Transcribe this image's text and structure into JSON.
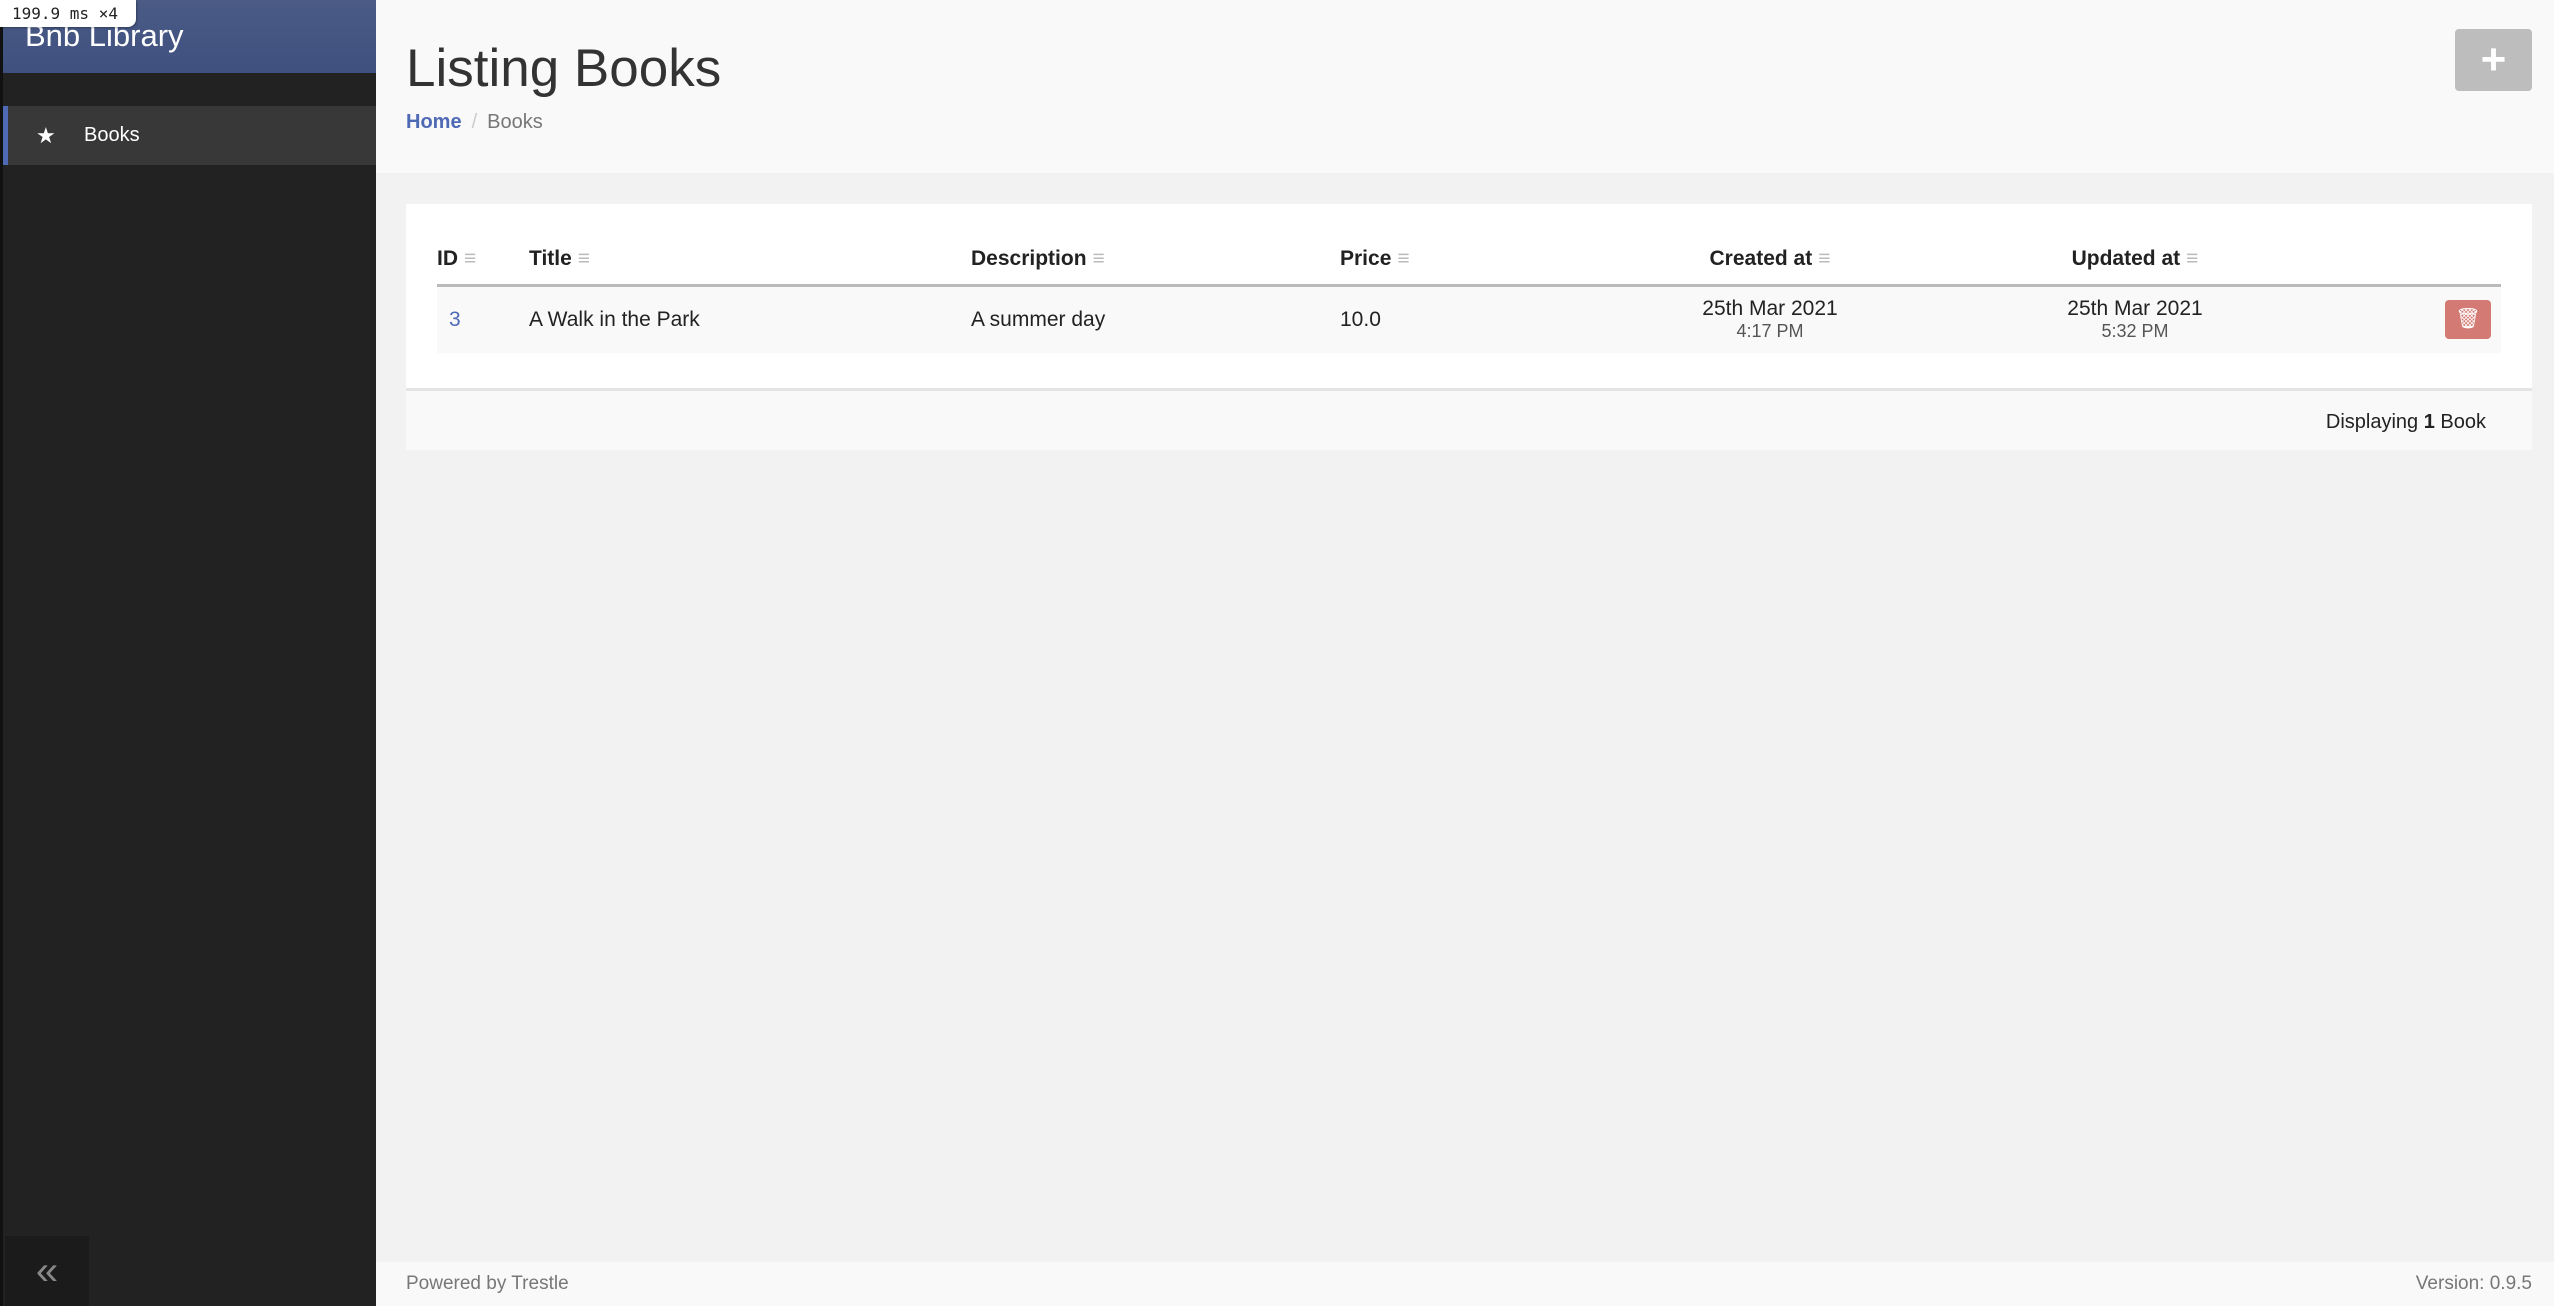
{
  "overlay": {
    "timing": "199.9 ms ×4"
  },
  "sidebar": {
    "brand": "Bnb Library",
    "items": [
      {
        "label": "Books",
        "icon": "star-icon"
      }
    ],
    "collapse_icon": "double-chevron-left-icon"
  },
  "header": {
    "title": "Listing Books",
    "breadcrumb": [
      "Home",
      "Books"
    ],
    "add_icon": "+"
  },
  "table": {
    "columns": [
      "ID",
      "Title",
      "Description",
      "Price",
      "Created at",
      "Updated at"
    ],
    "rows": [
      {
        "id": "3",
        "title": "A Walk in the Park",
        "description": "A summer day",
        "price": "10.0",
        "created_date": "25th Mar 2021",
        "created_time": "4:17 PM",
        "updated_date": "25th Mar 2021",
        "updated_time": "5:32 PM"
      }
    ],
    "footer": {
      "prefix": "Displaying",
      "count": "1",
      "suffix": "Book"
    }
  },
  "footer": {
    "powered": "Powered by Trestle",
    "version": "Version: 0.9.5"
  },
  "colors": {
    "accent": "#4f6ab5",
    "danger": "#d47a74",
    "sidebar": "#222222"
  }
}
